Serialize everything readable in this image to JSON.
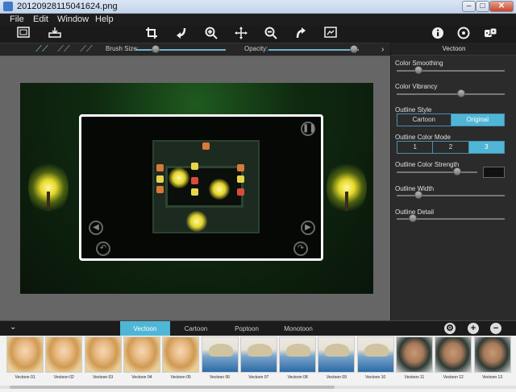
{
  "window": {
    "title": "20120928115041624.png",
    "min": "–",
    "max": "□",
    "close": "✕"
  },
  "menu": [
    "File",
    "Edit",
    "Window",
    "Help"
  ],
  "toolbar": {
    "left_icons": [
      "open-image-icon",
      "save-icon"
    ],
    "center_icons": [
      "crop-icon",
      "undo-icon",
      "zoom-in-icon",
      "pan-icon",
      "zoom-out-icon",
      "redo-icon",
      "fit-screen-icon"
    ],
    "right_icons": [
      "info-icon",
      "settings-icon",
      "dice-icon"
    ]
  },
  "subbar": {
    "brush_size_label": "Brush Size:",
    "opacity_label": "Opacity:",
    "brush_size": 0.22,
    "opacity": 0.95
  },
  "panel": {
    "title": "Vectoon",
    "color_smoothing": {
      "label": "Color Smoothing",
      "value": 0.2
    },
    "color_vibrancy": {
      "label": "Color Vibrancy",
      "value": 0.6
    },
    "outline_style": {
      "label": "Outline Style",
      "options": [
        "Cartoon",
        "Original"
      ],
      "selected": "Original"
    },
    "outline_color_mode": {
      "label": "Outline Color Mode",
      "options": [
        "1",
        "2",
        "3"
      ],
      "selected": "3"
    },
    "outline_color_strength": {
      "label": "Outline Color Strength",
      "value": 0.75
    },
    "outline_width": {
      "label": "Outline Width",
      "value": 0.2
    },
    "outline_detail": {
      "label": "Outline Detail",
      "value": 0.15
    }
  },
  "styles_bar": {
    "tabs": [
      "Vectoon",
      "Cartoon",
      "Poptoon",
      "Monotoon"
    ],
    "active": "Vectoon"
  },
  "thumbnails": [
    {
      "label": "Vectoon 01",
      "kind": "blonde"
    },
    {
      "label": "Vectoon 02",
      "kind": "blonde"
    },
    {
      "label": "Vectoon 03",
      "kind": "blonde"
    },
    {
      "label": "Vectoon 04",
      "kind": "blonde"
    },
    {
      "label": "Vectoon 05",
      "kind": "blonde"
    },
    {
      "label": "Vectoon 06",
      "kind": "hat"
    },
    {
      "label": "Vectoon 07",
      "kind": "hat"
    },
    {
      "label": "Vectoon 08",
      "kind": "hat"
    },
    {
      "label": "Vectoon 09",
      "kind": "hat"
    },
    {
      "label": "Vectoon 10",
      "kind": "hat"
    },
    {
      "label": "Vectoon 11",
      "kind": "man"
    },
    {
      "label": "Vectoon 12",
      "kind": "man"
    },
    {
      "label": "Vectoon 13",
      "kind": "man"
    }
  ],
  "colors": {
    "accent": "#4fb6d6",
    "background": "#2b2b2b",
    "workspace": "#666666"
  }
}
